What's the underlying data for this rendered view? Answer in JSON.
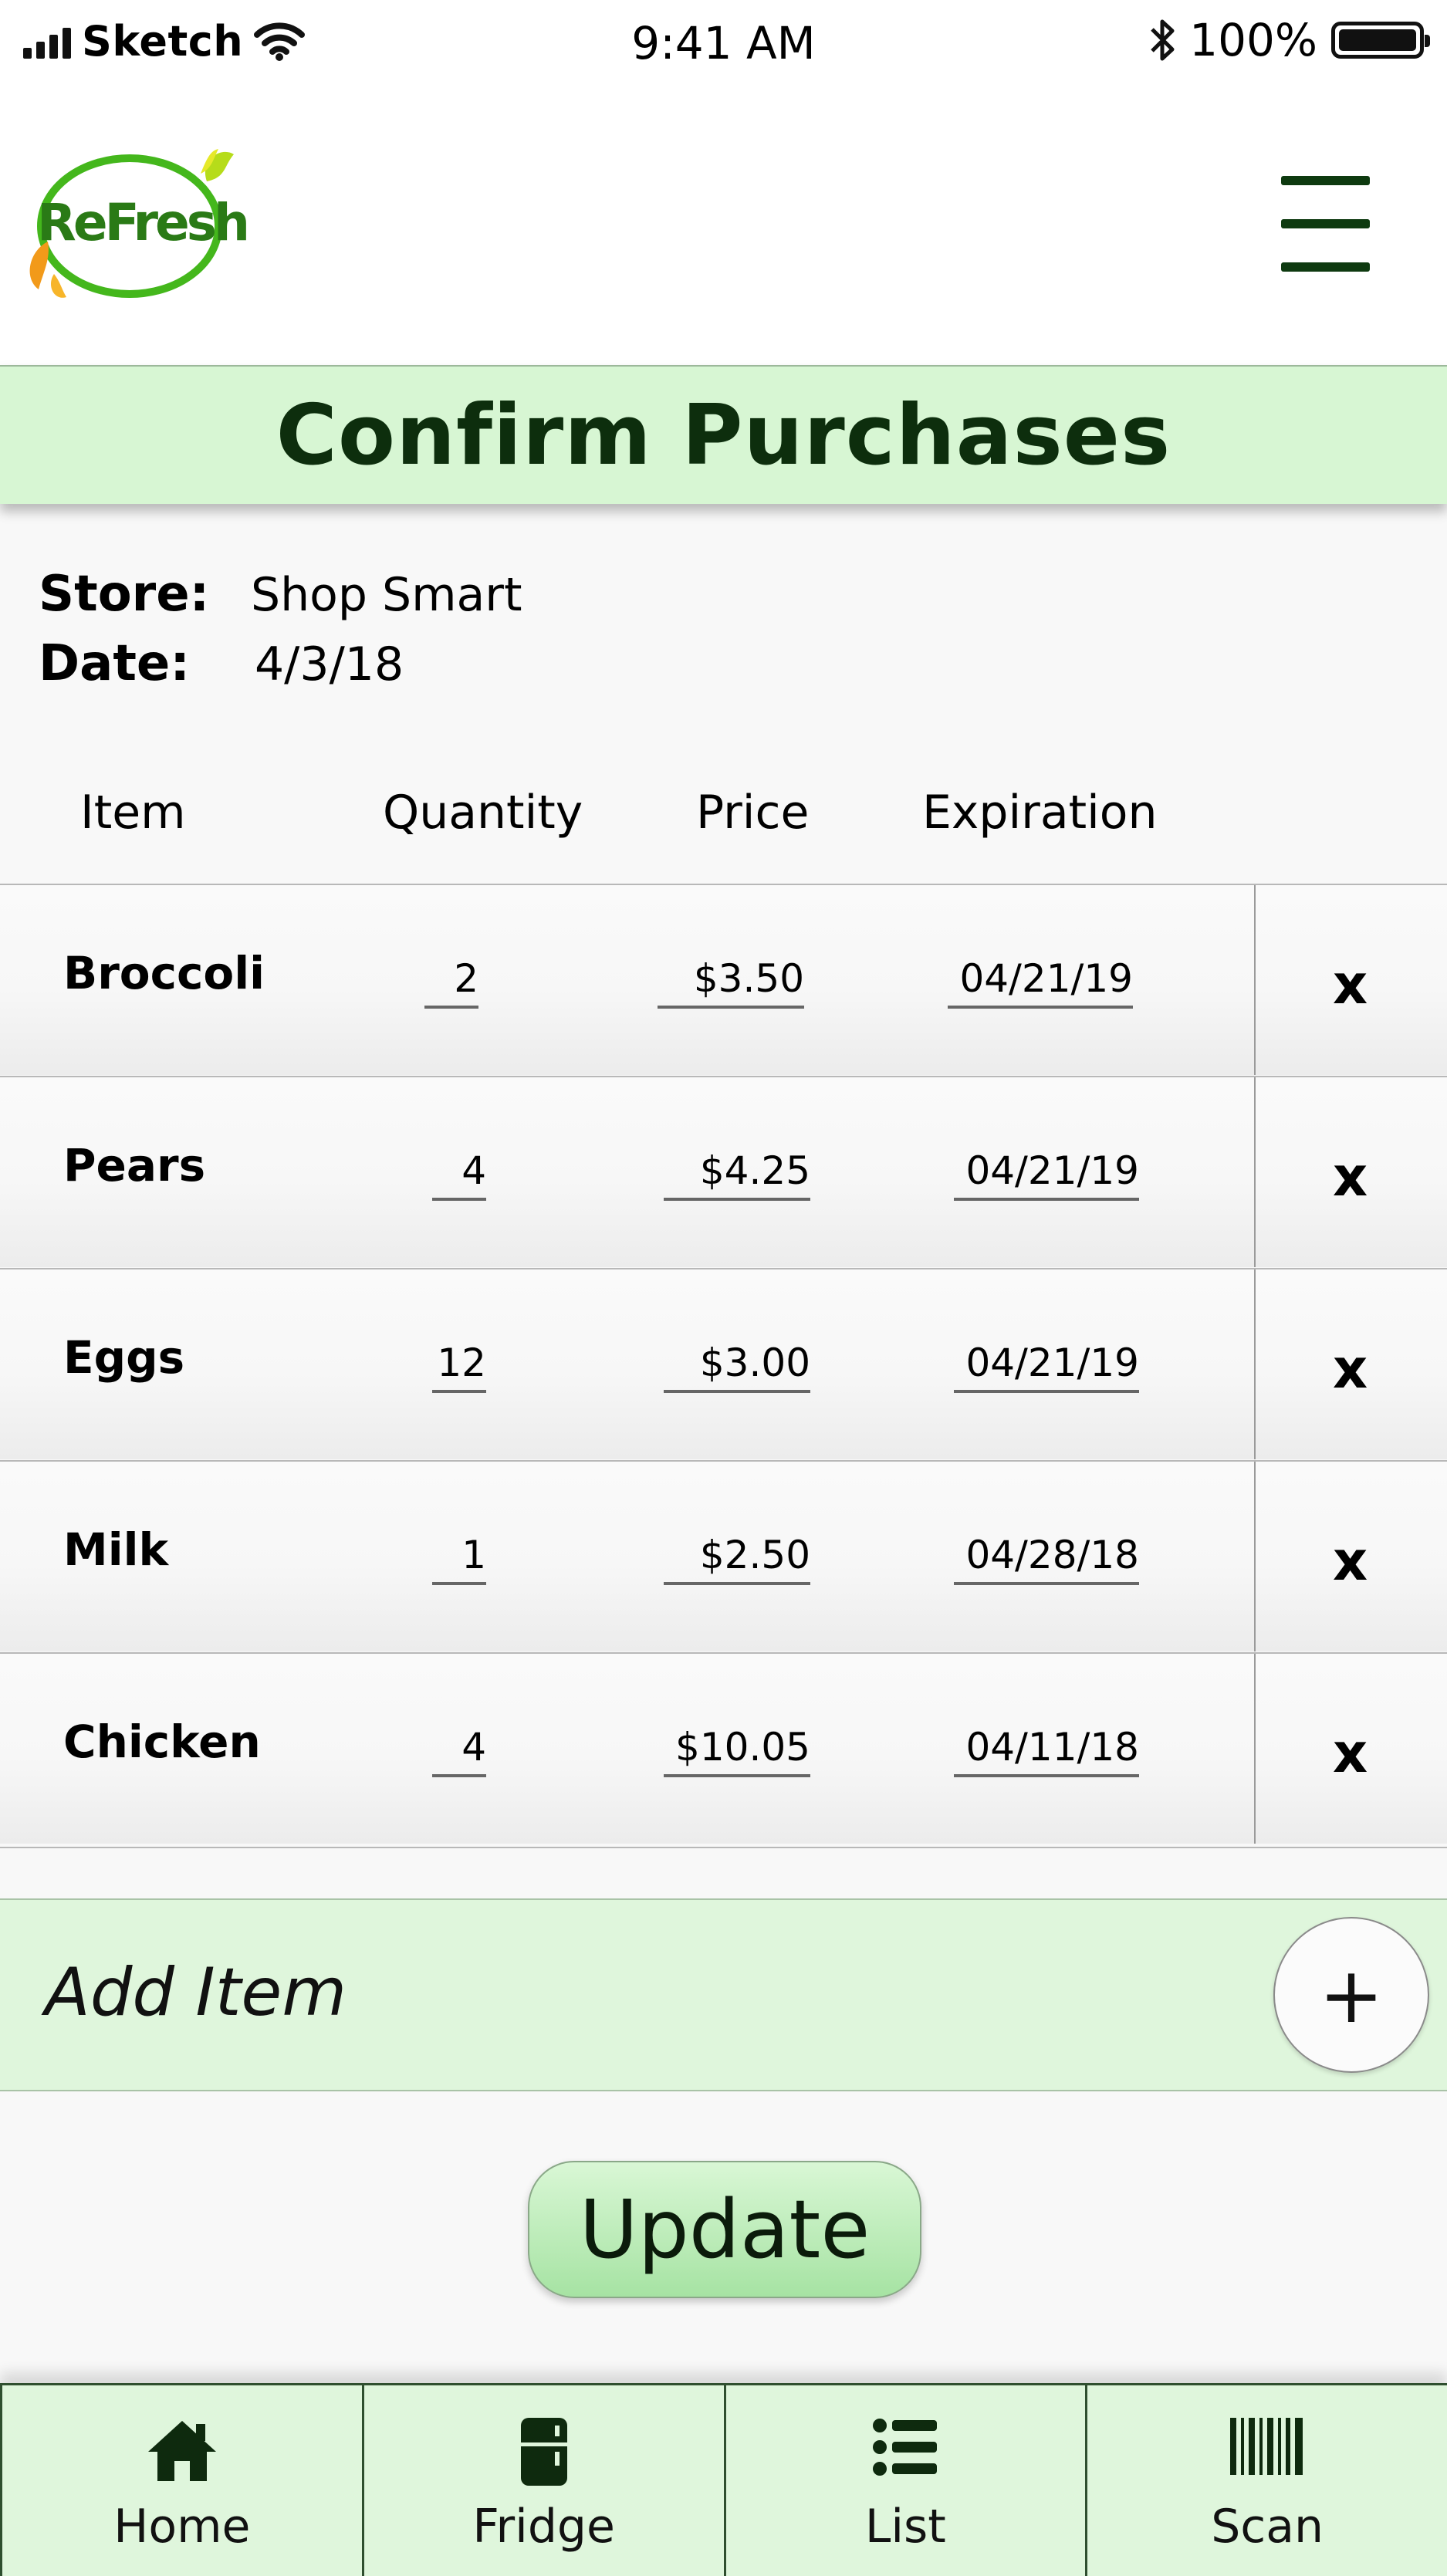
{
  "status_bar": {
    "carrier": "Sketch",
    "time": "9:41 AM",
    "battery": "100%",
    "battery_level": 1.0
  },
  "header": {
    "logo_text": "ReFresh",
    "menu_icon": "hamburger-menu-icon"
  },
  "page": {
    "title": "Confirm Purchases"
  },
  "purchase": {
    "store_label": "Store:",
    "store": "Shop Smart",
    "date_label": "Date:",
    "date": "4/3/18"
  },
  "table": {
    "headers": {
      "item": "Item",
      "quantity": "Quantity",
      "price": "Price",
      "expiration": "Expiration"
    },
    "rows": [
      {
        "item": "Broccoli",
        "quantity": "2",
        "price": "$3.50",
        "expiration": "04/21/19",
        "remove": "x"
      },
      {
        "item": "Pears",
        "quantity": "4",
        "price": "$4.25",
        "expiration": "04/21/19",
        "remove": "x"
      },
      {
        "item": "Eggs",
        "quantity": "12",
        "price": "$3.00",
        "expiration": "04/21/19",
        "remove": "x"
      },
      {
        "item": "Milk",
        "quantity": "1",
        "price": "$2.50",
        "expiration": "04/28/18",
        "remove": "x"
      },
      {
        "item": "Chicken",
        "quantity": "4",
        "price": "$10.05",
        "expiration": "04/11/18",
        "remove": "x"
      }
    ]
  },
  "add_item": {
    "label": "Add Item",
    "button": "+"
  },
  "update_button": "Update",
  "tabs": [
    {
      "label": "Home",
      "icon": "home-icon"
    },
    {
      "label": "Fridge",
      "icon": "fridge-icon"
    },
    {
      "label": "List",
      "icon": "list-icon"
    },
    {
      "label": "Scan",
      "icon": "barcode-icon"
    }
  ],
  "colors": {
    "accent_green": "#d7f6d3",
    "dark_green": "#0d2e0d",
    "logo_green": "#2a7a16"
  }
}
